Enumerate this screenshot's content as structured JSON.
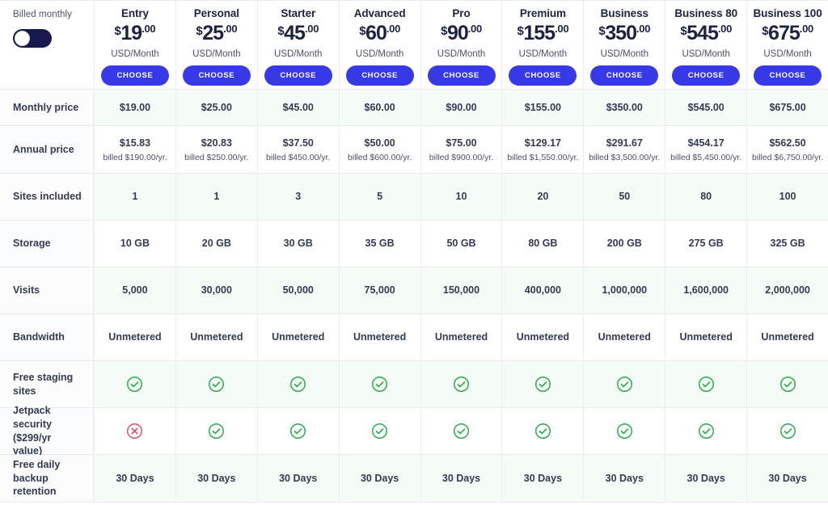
{
  "toggle": {
    "label": "Billed monthly",
    "state": "monthly",
    "on_color": "#181a4d"
  },
  "accent_color": "#3739e8",
  "choose_label": "CHOOSE",
  "currency_label": "USD/Month",
  "plans": [
    {
      "name": "Entry",
      "currency": "$",
      "amount": "19",
      "cents": ".00"
    },
    {
      "name": "Personal",
      "currency": "$",
      "amount": "25",
      "cents": ".00"
    },
    {
      "name": "Starter",
      "currency": "$",
      "amount": "45",
      "cents": ".00"
    },
    {
      "name": "Advanced",
      "currency": "$",
      "amount": "60",
      "cents": ".00"
    },
    {
      "name": "Pro",
      "currency": "$",
      "amount": "90",
      "cents": ".00"
    },
    {
      "name": "Premium",
      "currency": "$",
      "amount": "155",
      "cents": ".00"
    },
    {
      "name": "Business",
      "currency": "$",
      "amount": "350",
      "cents": ".00"
    },
    {
      "name": "Business 80",
      "currency": "$",
      "amount": "545",
      "cents": ".00"
    },
    {
      "name": "Business 100",
      "currency": "$",
      "amount": "675",
      "cents": ".00"
    }
  ],
  "rows": {
    "monthly_price": {
      "label": "Monthly price",
      "values": [
        "$19.00",
        "$25.00",
        "$45.00",
        "$60.00",
        "$90.00",
        "$155.00",
        "$350.00",
        "$545.00",
        "$675.00"
      ]
    },
    "annual_price": {
      "label": "Annual price",
      "values": [
        "$15.83",
        "$20.83",
        "$37.50",
        "$50.00",
        "$75.00",
        "$129.17",
        "$291.67",
        "$454.17",
        "$562.50"
      ],
      "subvalues": [
        "billed $190.00/yr.",
        "billed $250.00/yr.",
        "billed $450.00/yr.",
        "billed $600.00/yr.",
        "billed $900.00/yr.",
        "billed $1,550.00/yr.",
        "billed $3,500.00/yr.",
        "billed $5,450.00/yr.",
        "billed $6,750.00/yr."
      ]
    },
    "sites_included": {
      "label": "Sites included",
      "values": [
        "1",
        "1",
        "3",
        "5",
        "10",
        "20",
        "50",
        "80",
        "100"
      ]
    },
    "storage": {
      "label": "Storage",
      "values": [
        "10 GB",
        "20 GB",
        "30 GB",
        "35 GB",
        "50 GB",
        "80 GB",
        "200 GB",
        "275 GB",
        "325 GB"
      ]
    },
    "visits": {
      "label": "Visits",
      "values": [
        "5,000",
        "30,000",
        "50,000",
        "75,000",
        "150,000",
        "400,000",
        "1,000,000",
        "1,600,000",
        "2,000,000"
      ]
    },
    "bandwidth": {
      "label": "Bandwidth",
      "values": [
        "Unmetered",
        "Unmetered",
        "Unmetered",
        "Unmetered",
        "Unmetered",
        "Unmetered",
        "Unmetered",
        "Unmetered",
        "Unmetered"
      ]
    },
    "free_staging_sites": {
      "label": "Free staging sites",
      "icons": [
        "check",
        "check",
        "check",
        "check",
        "check",
        "check",
        "check",
        "check",
        "check"
      ]
    },
    "jetpack_security": {
      "label": "Jetpack security ($299/yr value)",
      "icons": [
        "cross",
        "check",
        "check",
        "check",
        "check",
        "check",
        "check",
        "check",
        "check"
      ]
    },
    "free_daily_backup_retention": {
      "label": "Free daily backup retention",
      "values": [
        "30 Days",
        "30 Days",
        "30 Days",
        "30 Days",
        "30 Days",
        "30 Days",
        "30 Days",
        "30 Days",
        "30 Days"
      ]
    }
  },
  "icon_colors": {
    "check": "#2eaa4e",
    "cross": "#d4556f"
  }
}
